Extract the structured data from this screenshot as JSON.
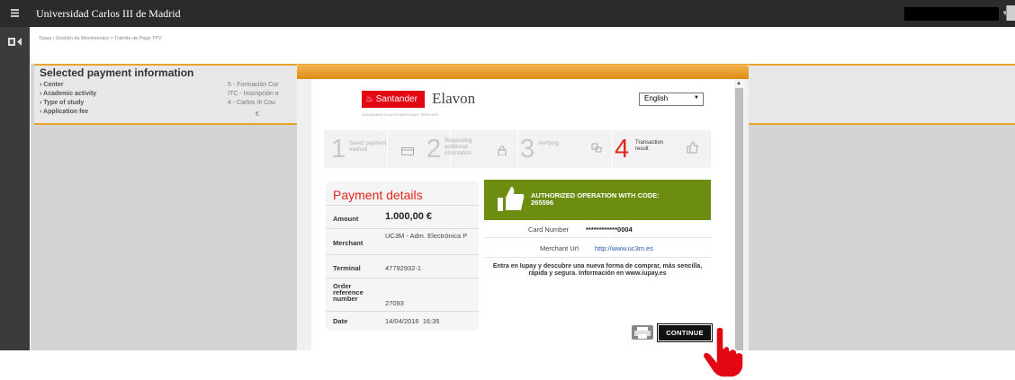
{
  "app": {
    "title": "Universidad Carlos III de Madrid"
  },
  "breadcrumb": "Tasas  /  Gestión de Movimientos > Trámite de Pago TPV",
  "selected": {
    "title": "Selected payment information",
    "rows": [
      {
        "label": "Center",
        "value": "5 - Formación Cor"
      },
      {
        "label": "Academic activity",
        "value": "ITC - Inscripción e"
      },
      {
        "label": "Type of study",
        "value": "4 - Carlos III Cou"
      },
      {
        "label": "Application fee",
        "value": "€"
      }
    ]
  },
  "modal": {
    "logos": {
      "santander": "Santander",
      "elavon": "Elavon",
      "sub": "SANTANDER ELAVON MERCHANT SERVICES"
    },
    "language": {
      "selected": "English"
    },
    "steps": [
      {
        "num": "1",
        "text": "Select payment method"
      },
      {
        "num": "2",
        "text": "Requesting additional information"
      },
      {
        "num": "3",
        "text": "Verifying"
      },
      {
        "num": "4",
        "text": "Transaction result"
      }
    ],
    "payment": {
      "title": "Payment details",
      "amount_label": "Amount",
      "amount": "1.000,00 €",
      "merchant_label": "Merchant",
      "merchant": "UC3M - Adm. Electrónica P",
      "terminal_label": "Terminal",
      "terminal": "47792932-1",
      "order_label": "Order reference number",
      "order": "27093",
      "date_label": "Date",
      "date": "14/04/2016  16:35"
    },
    "auth": {
      "line1": "AUTHORIZED OPERATION WITH CODE:",
      "code": "265596"
    },
    "card": {
      "label": "Card Number",
      "value": "************0004"
    },
    "merchant_url": {
      "label": "Merchant Url",
      "value": "http://www.uc3m.es"
    },
    "promo": "Entra en Iupay y descubre una nueva forma de comprar, más sencilla, rápida y segura. Información en www.iupay.es",
    "continue_label": "CONTINUE"
  },
  "colors": {
    "accent": "#e8a32c",
    "santander_red": "#e30613",
    "auth_green": "#6c8d10",
    "step_active": "#e1261c"
  }
}
